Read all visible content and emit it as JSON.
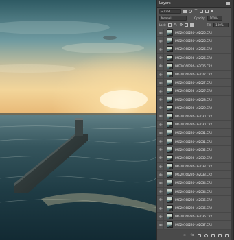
{
  "panel": {
    "title": "Layers",
    "filter": {
      "kind_label": "Kind"
    },
    "blend": {
      "mode": "Normal",
      "opacity_label": "Opacity:",
      "opacity_value": "100%"
    },
    "lock": {
      "label": "Lock:",
      "fill_label": "Fill:",
      "fill_value": "100%"
    },
    "layers": [
      "IMG20160226-162025.CR2",
      "IMG20160226-162025.CR2",
      "IMG20160226-162026.CR2",
      "IMG20160226-162026.CR2",
      "IMG20160226-162026.CR2",
      "IMG20160226-162027.CR2",
      "IMG20160226-162027.CR2",
      "IMG20160226-162027.CR2",
      "IMG20160226-162028.CR2",
      "IMG20160226-162029.CR2",
      "IMG20160226-162030.CR2",
      "IMG20160226-162030.CR2",
      "IMG20160226-162031.CR2",
      "IMG20160226-162031.CR2",
      "IMG20160226-162032.CR2",
      "IMG20160226-162032.CR2",
      "IMG20160226-162033.CR2",
      "IMG20160226-162033.CR2",
      "IMG20160226-162034.CR2",
      "IMG20160226-162034.CR2",
      "IMG20160226-162035.CR2",
      "IMG20160226-162036.CR2",
      "IMG20160226-162036.CR2",
      "IMG20160226-162037.CR2"
    ]
  }
}
